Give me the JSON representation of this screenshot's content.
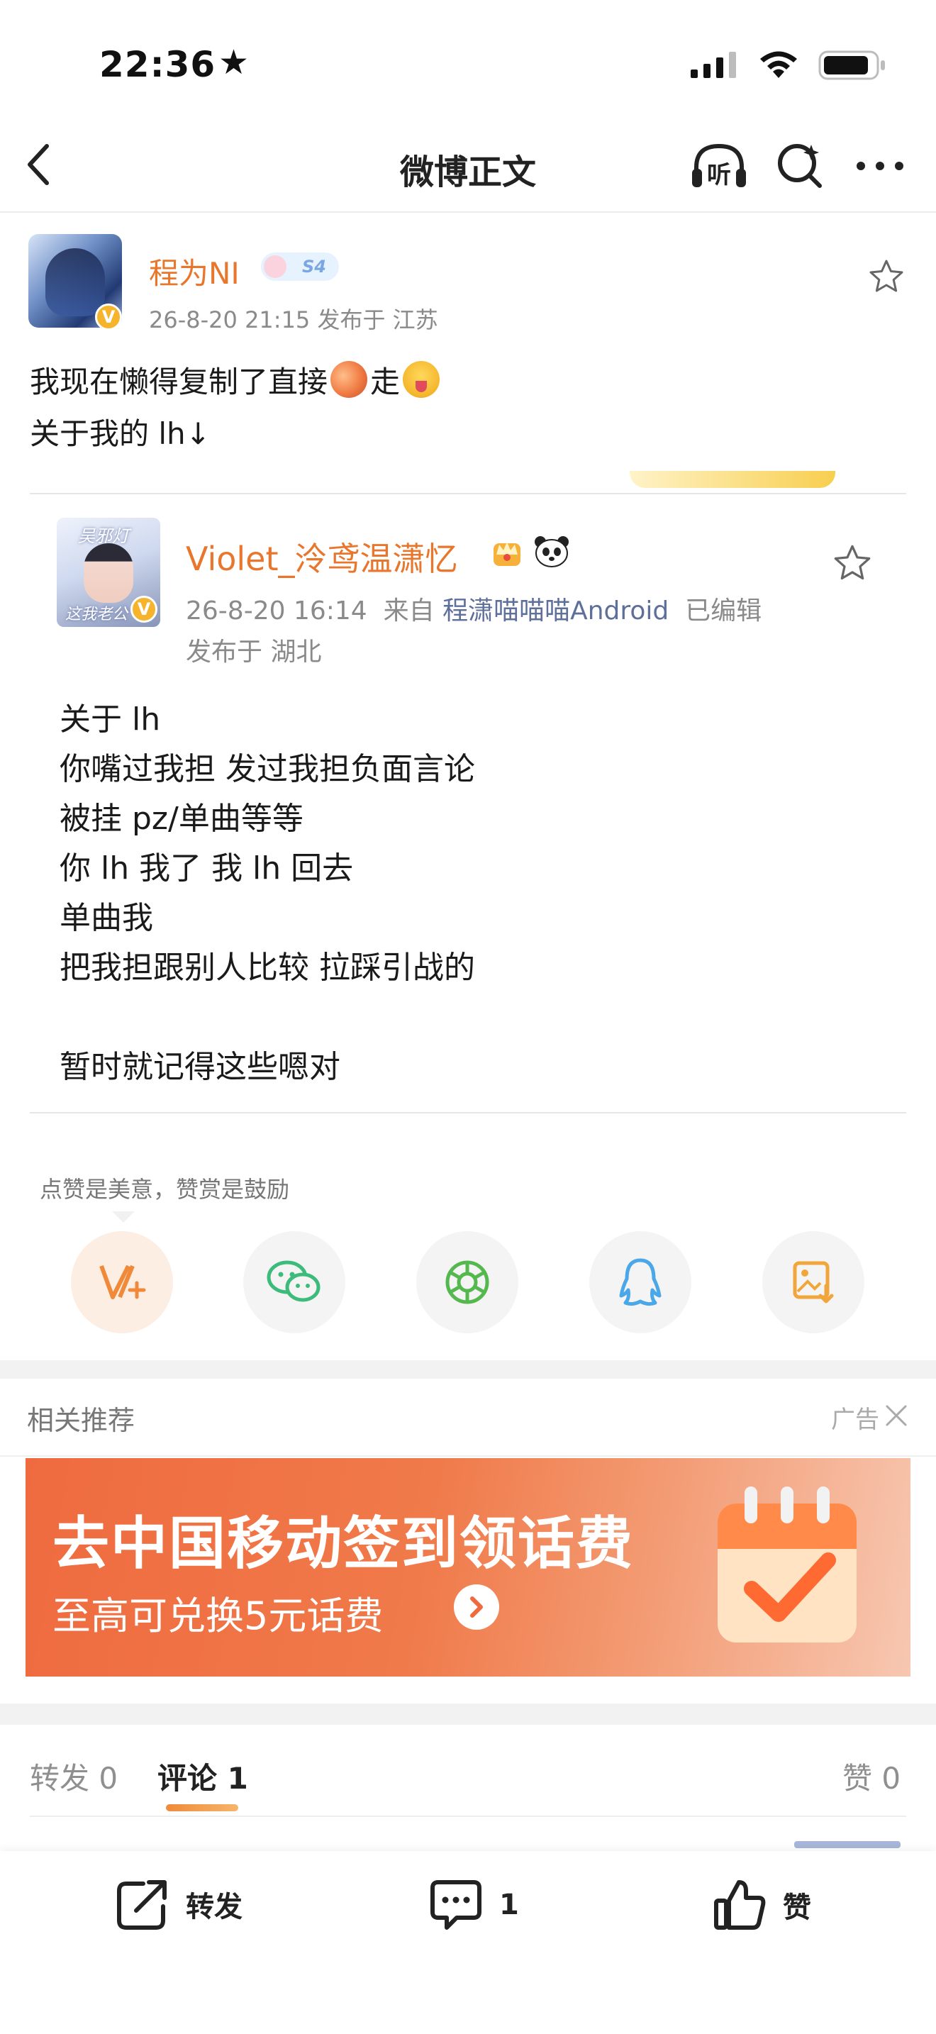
{
  "status_bar": {
    "time": "22:36",
    "star": "★"
  },
  "nav": {
    "title": "微博正文",
    "listen_label": "听"
  },
  "post": {
    "author": "程为NI",
    "level_badge": "S4",
    "verified_badge": "V",
    "meta": "26-8-20 21:15  发布于 江苏",
    "line1_a": "我现在懒得复制了直接",
    "line1_b": "走",
    "line2": "关于我的 lh↓"
  },
  "quoted": {
    "author": "Violet_泠鸢温潇忆",
    "avatar_text_top": "吴邪灯",
    "avatar_text_bottom": "这我老公",
    "verified_badge": "V",
    "time": "26-8-20 16:14",
    "from_label": "来自",
    "source": "程潇喵喵喵Android",
    "edited": "已编辑",
    "location": "发布于 湖北",
    "lines": [
      "关于 lh",
      "你嘴过我担 发过我担负面言论",
      "被挂 pz/单曲等等",
      "你 lh 我了 我 lh 回去",
      "单曲我",
      "把我担跟别人比较 拉踩引战的",
      "",
      "暂时就记得这些嗯对"
    ]
  },
  "share": {
    "tip": "点赞是美意，赞赏是鼓励"
  },
  "recommend": {
    "title": "相关推荐",
    "ad_label": "广告",
    "banner_title": "去中国移动签到领话费",
    "banner_subtitle": "至高可兑换5元话费"
  },
  "tabs": {
    "repost": "转发 0",
    "comment": "评论 1",
    "like": "赞 0"
  },
  "toolbar": {
    "repost": "转发",
    "comment": "1",
    "like": "赞"
  },
  "colors": {
    "accent": "#e8772d",
    "link": "#5d6f9a"
  }
}
